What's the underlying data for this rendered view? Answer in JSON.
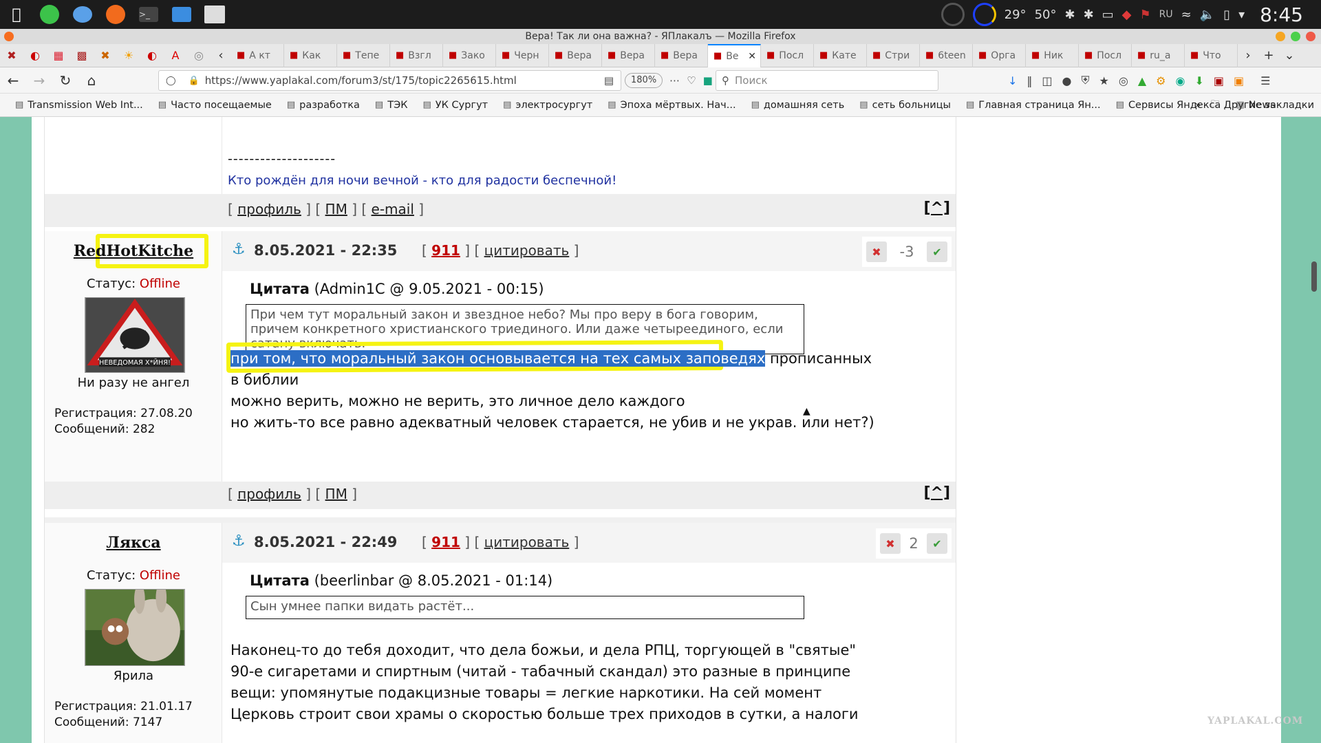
{
  "os_panel": {
    "apps": [
      "apple-icon",
      "green-app-icon",
      "chat-icon",
      "firefox-icon",
      "terminal-icon",
      "files-icon",
      "screenshot-icon"
    ],
    "temp1": "29°",
    "temp2": "50°",
    "lang": "RU",
    "clock": "8:45"
  },
  "window": {
    "title": "Вера! Так ли она важна? - ЯПлакалъ — Mozilla Firefox"
  },
  "tabs": [
    {
      "label": "А кт"
    },
    {
      "label": "Как"
    },
    {
      "label": "Тепе"
    },
    {
      "label": "Взгл"
    },
    {
      "label": "Зако"
    },
    {
      "label": "Черн"
    },
    {
      "label": "Вера"
    },
    {
      "label": "Вера"
    },
    {
      "label": "Вера"
    },
    {
      "label": "Ве",
      "active": true
    },
    {
      "label": "Посл"
    },
    {
      "label": "Кате"
    },
    {
      "label": "Стри"
    },
    {
      "label": "6teen"
    },
    {
      "label": "Орга"
    },
    {
      "label": "Ник"
    },
    {
      "label": "Посл"
    },
    {
      "label": "ru_a"
    },
    {
      "label": "Что"
    }
  ],
  "navbar": {
    "url": "https://www.yaplakal.com/forum3/st/175/topic2265615.html",
    "zoom": "180%",
    "search_placeholder": "Поиск"
  },
  "bookmarks": {
    "items": [
      "Transmission Web Int...",
      "Часто посещаемые",
      "разработка",
      "ТЭК",
      "УК Сургут",
      "электросургут",
      "Эпоха мёртвых. Нач...",
      "домашняя сеть",
      "сеть больницы",
      "Главная страница Ян...",
      "Сервисы Яндекса",
      "News"
    ],
    "other": "Другие закладки"
  },
  "prev_post": {
    "sig_dash": "--------------------",
    "signature": "Кто рождён для ночи вечной - кто для радости беспечной!",
    "links": {
      "profile": "профиль",
      "pm": "ПМ",
      "email": "e-mail"
    },
    "up": "[^]"
  },
  "post1": {
    "username": "RedHotKitche",
    "status_label": "Статус:",
    "status": "Offline",
    "avatar_caption": "НЕВЕДОМАЯ Х*ЙНЯ!",
    "user_title": "Ни разу не ангел",
    "registration": "Регистрация: 27.08.20",
    "messages": "Сообщений: 282",
    "date": "8.05.2021 - 22:35",
    "num": "911",
    "cite": "цитировать",
    "score": "-3",
    "quote_label": "Цитата",
    "quote_meta": "(Admin1C @ 9.05.2021 - 00:15)",
    "quote_text": "При чем тут моральный закон и звездное небо? Мы про веру в бога говорим, причем конкретного христианского триединого. Или даже четыреединого, если сатану включать.",
    "body_selected": "при том, что моральный закон основывается на тех самых заповедях",
    "body_rest": " прописанных",
    "body_line2": "в библии",
    "body_line3": "можно верить, можно не верить, это личное дело каждого",
    "body_line4": "но жить-то все равно адекватный человек старается, не убив и не украв. или нет?)",
    "links": {
      "profile": "профиль",
      "pm": "ПМ"
    },
    "up": "[^]"
  },
  "post2": {
    "username": "Лякса",
    "status_label": "Статус:",
    "status": "Offline",
    "user_title": "Ярила",
    "registration": "Регистрация: 21.01.17",
    "messages": "Сообщений: 7147",
    "date": "8.05.2021 - 22:49",
    "num": "911",
    "cite": "цитировать",
    "score": "2",
    "quote_label": "Цитата",
    "quote_meta": "(beerlinbar @ 8.05.2021 - 01:14)",
    "quote_text": "Сын умнее папки видать растёт...",
    "body_line1": "Наконец-то до тебя доходит, что дела божьи, и дела РПЦ, торгующей в \"святые\"",
    "body_line2": "90-е сигаретами и спиртным (читай - табачный скандал) это разные в принципе",
    "body_line3": "вещи: упомянутые подакцизные товары = легкие наркотики. На сей момент",
    "body_line4": "Церковь строит свои храмы о скоростью больше трех приходов в сутки, а налоги"
  },
  "watermark": "YAPLAKAL.COM",
  "colors": {
    "page_bg": "#7fc7ad",
    "highlight": "#f5f312",
    "selection": "#2c6ec5",
    "offline": "#c00000",
    "signature": "#2032a0"
  }
}
